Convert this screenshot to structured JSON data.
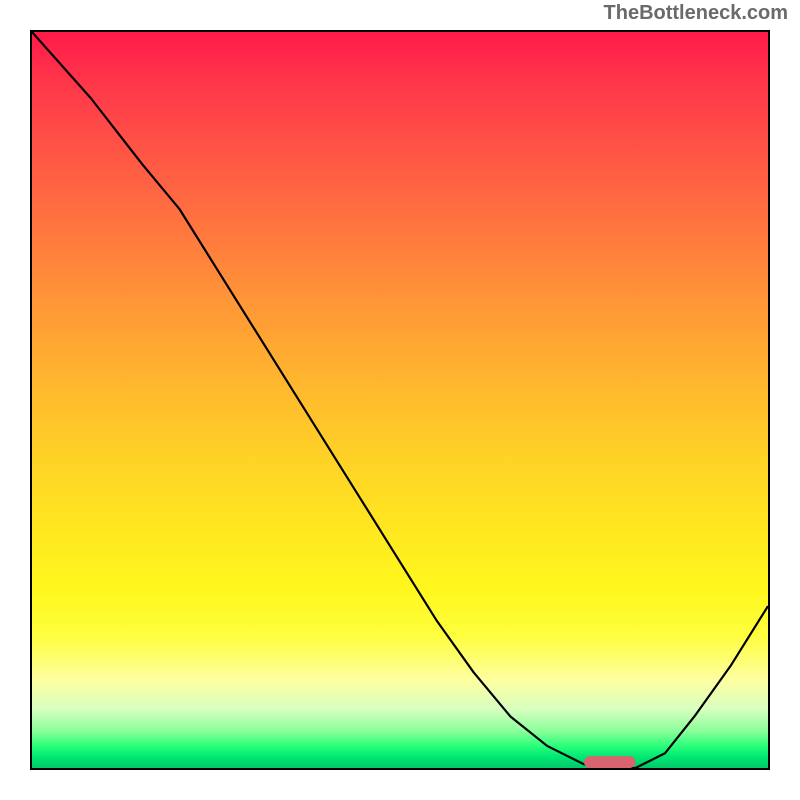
{
  "watermark": "TheBottleneck.com",
  "chart_data": {
    "type": "line",
    "title": "",
    "xlabel": "",
    "ylabel": "",
    "xlim": [
      0,
      100
    ],
    "ylim": [
      0,
      100
    ],
    "grid": false,
    "legend": false,
    "series": [
      {
        "name": "bottleneck-curve",
        "x": [
          0,
          8,
          15,
          20,
          25,
          30,
          35,
          40,
          45,
          50,
          55,
          60,
          65,
          70,
          75,
          78,
          82,
          86,
          90,
          95,
          100
        ],
        "values": [
          100,
          91,
          82,
          76,
          68,
          60,
          52,
          44,
          36,
          28,
          20,
          13,
          7,
          3,
          0.5,
          0,
          0,
          2,
          7,
          14,
          22
        ]
      }
    ],
    "marker": {
      "name": "optimal-zone",
      "x_start": 75,
      "x_end": 82,
      "y": 0,
      "color": "#d9636e"
    },
    "background": {
      "type": "vertical-gradient",
      "stops": [
        {
          "pos": 0.0,
          "color": "#ff1a4a"
        },
        {
          "pos": 0.5,
          "color": "#ffd226"
        },
        {
          "pos": 0.85,
          "color": "#feffa0"
        },
        {
          "pos": 1.0,
          "color": "#00c86a"
        }
      ]
    }
  }
}
